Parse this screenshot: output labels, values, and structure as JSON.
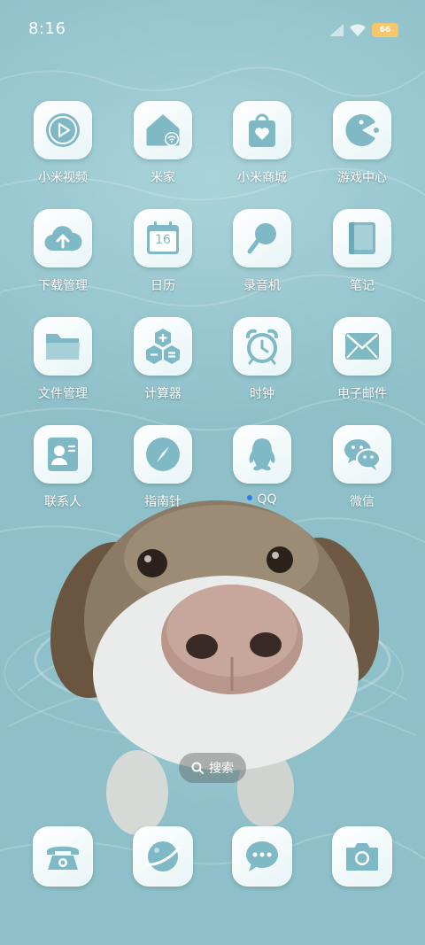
{
  "status_bar": {
    "time": "8:16",
    "battery_label": "66"
  },
  "apps": [
    {
      "label": "小米视频",
      "icon": "play-icon"
    },
    {
      "label": "米家",
      "icon": "home-wifi-icon"
    },
    {
      "label": "小米商城",
      "icon": "shopping-bag-icon"
    },
    {
      "label": "游戏中心",
      "icon": "pacman-icon"
    },
    {
      "label": "下载管理",
      "icon": "cloud-upload-icon"
    },
    {
      "label": "日历",
      "icon": "calendar-icon",
      "calendar_day": "16"
    },
    {
      "label": "录音机",
      "icon": "microphone-icon"
    },
    {
      "label": "笔记",
      "icon": "notebook-icon"
    },
    {
      "label": "文件管理",
      "icon": "folder-icon"
    },
    {
      "label": "计算器",
      "icon": "calculator-icon"
    },
    {
      "label": "时钟",
      "icon": "alarm-clock-icon"
    },
    {
      "label": "电子邮件",
      "icon": "envelope-icon"
    },
    {
      "label": "联系人",
      "icon": "contact-card-icon"
    },
    {
      "label": "指南针",
      "icon": "compass-icon"
    },
    {
      "label": "QQ",
      "icon": "penguin-icon",
      "notification_dot": true
    },
    {
      "label": "微信",
      "icon": "wechat-icon"
    }
  ],
  "search": {
    "label": "搜索",
    "icon": "search-icon"
  },
  "dock": [
    {
      "icon": "phone-icon"
    },
    {
      "icon": "browser-planet-icon"
    },
    {
      "icon": "message-bubble-icon"
    },
    {
      "icon": "camera-icon"
    }
  ],
  "colors": {
    "icon_fill": "#7fb9c6",
    "tile_bg": "#f4fbfc",
    "water": "#9ccbd3",
    "notification_dot": "#2f7bf5"
  }
}
